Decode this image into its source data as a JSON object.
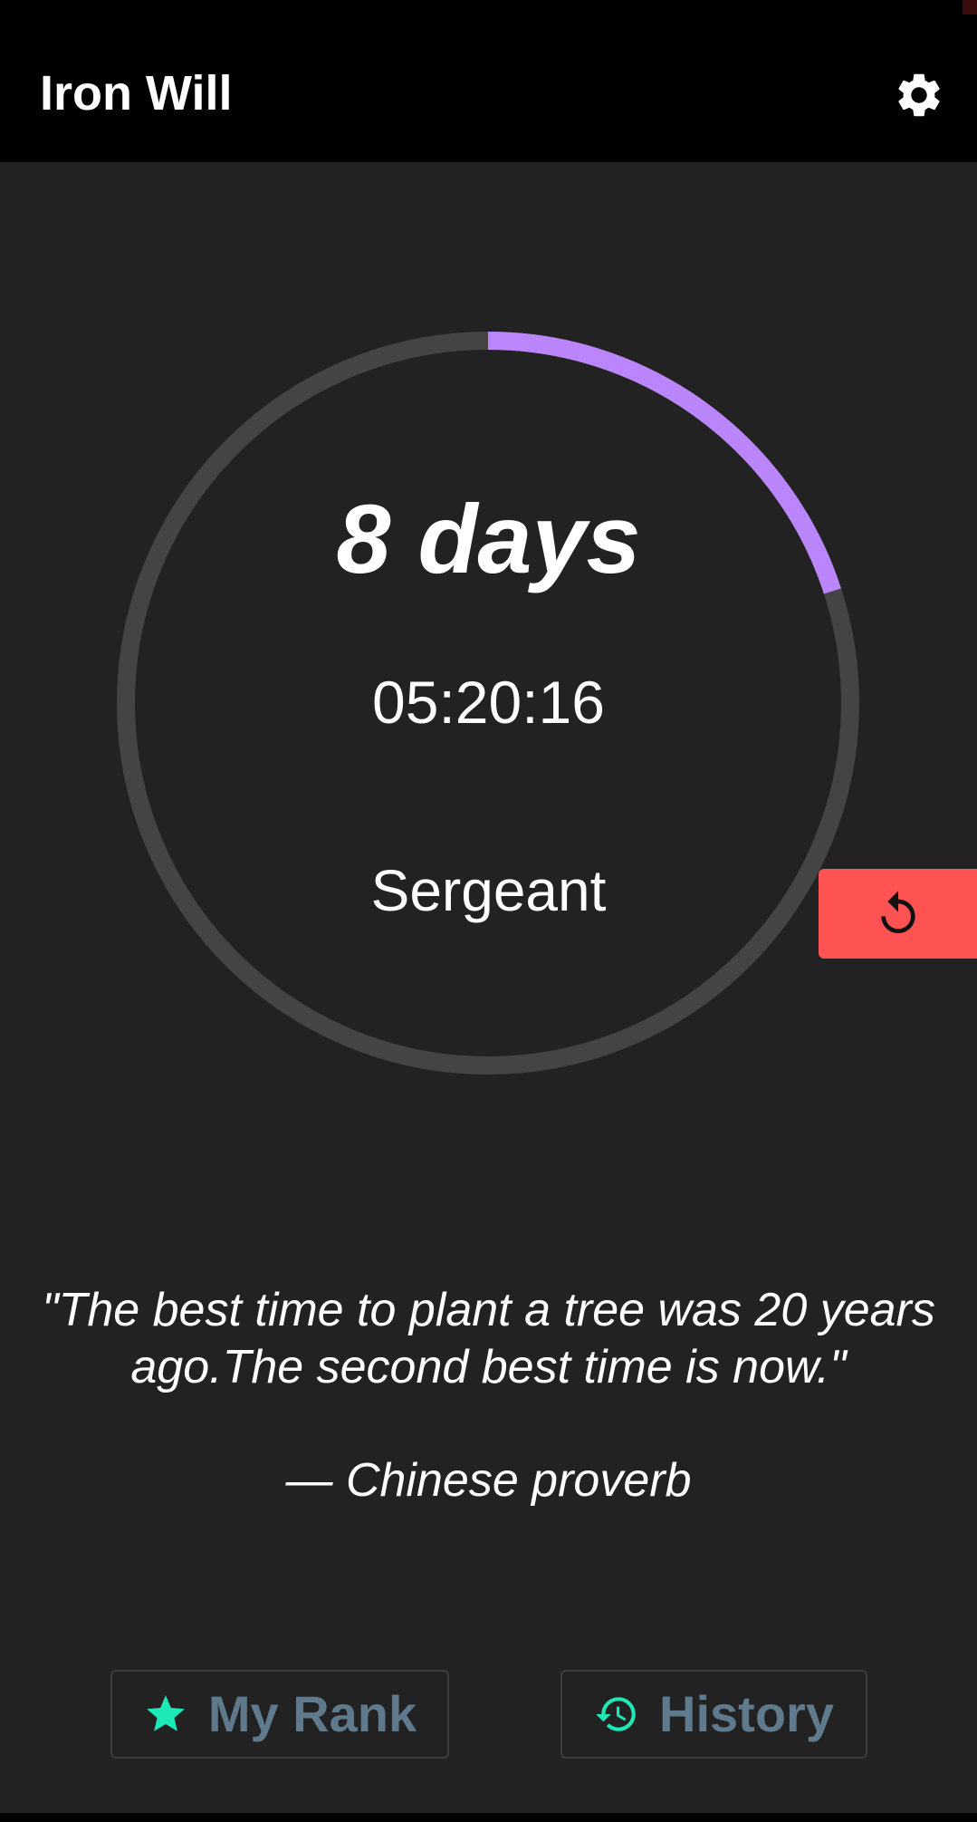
{
  "app_bar": {
    "title": "Iron Will",
    "settings_icon": "gear-icon"
  },
  "counter": {
    "days_text": "8 days",
    "timer_text": "05:20:16",
    "rank_text": "Sergeant",
    "progress_fraction": 0.2
  },
  "reset_button": {
    "icon": "reset-icon"
  },
  "quote": {
    "text": "\"The best time to plant a tree was 20 years ago.The second best time is now.\"",
    "author": "— Chinese proverb"
  },
  "bottom_buttons": {
    "my_rank_label": "My Rank",
    "my_rank_icon": "star-icon",
    "history_label": "History",
    "history_icon": "history-icon"
  },
  "colors": {
    "background": "#222222",
    "app_bar": "#000000",
    "progress": "#bb86fc",
    "ring_track": "#444444",
    "reset_button": "#ff5252",
    "accent_icon": "#1de9b6",
    "button_label": "#5f7a8c"
  }
}
